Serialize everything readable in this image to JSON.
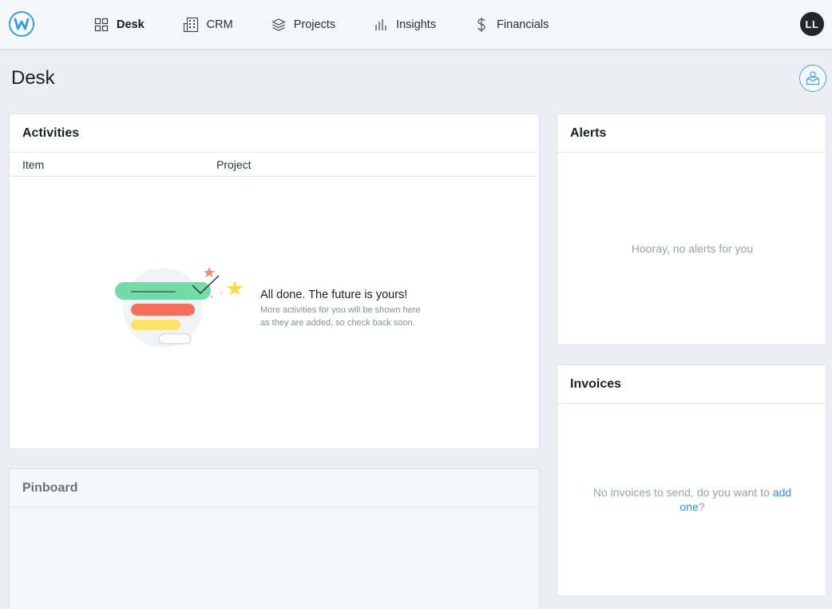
{
  "nav": {
    "items": [
      {
        "label": "Desk",
        "icon": "grid-icon",
        "active": true
      },
      {
        "label": "CRM",
        "icon": "building-icon",
        "active": false
      },
      {
        "label": "Projects",
        "icon": "layers-icon",
        "active": false
      },
      {
        "label": "Insights",
        "icon": "bar-chart-icon",
        "active": false
      },
      {
        "label": "Financials",
        "icon": "dollar-icon",
        "active": false
      }
    ],
    "avatar_initials": "LL"
  },
  "page": {
    "title": "Desk"
  },
  "activities": {
    "title": "Activities",
    "columns": [
      "Item",
      "Project"
    ],
    "empty_title": "All done. The future is yours!",
    "empty_line1": "More activities for you will be shown here",
    "empty_line2": "as they are added, so check back soon."
  },
  "pinboard": {
    "title": "Pinboard"
  },
  "alerts": {
    "title": "Alerts",
    "empty": "Hooray, no alerts for you"
  },
  "invoices": {
    "title": "Invoices",
    "empty_prefix": "No invoices to send, do you want to ",
    "link_text": "add one",
    "empty_suffix": "?"
  },
  "colors": {
    "accent": "#2f8fdf",
    "background": "#ebeef2"
  }
}
